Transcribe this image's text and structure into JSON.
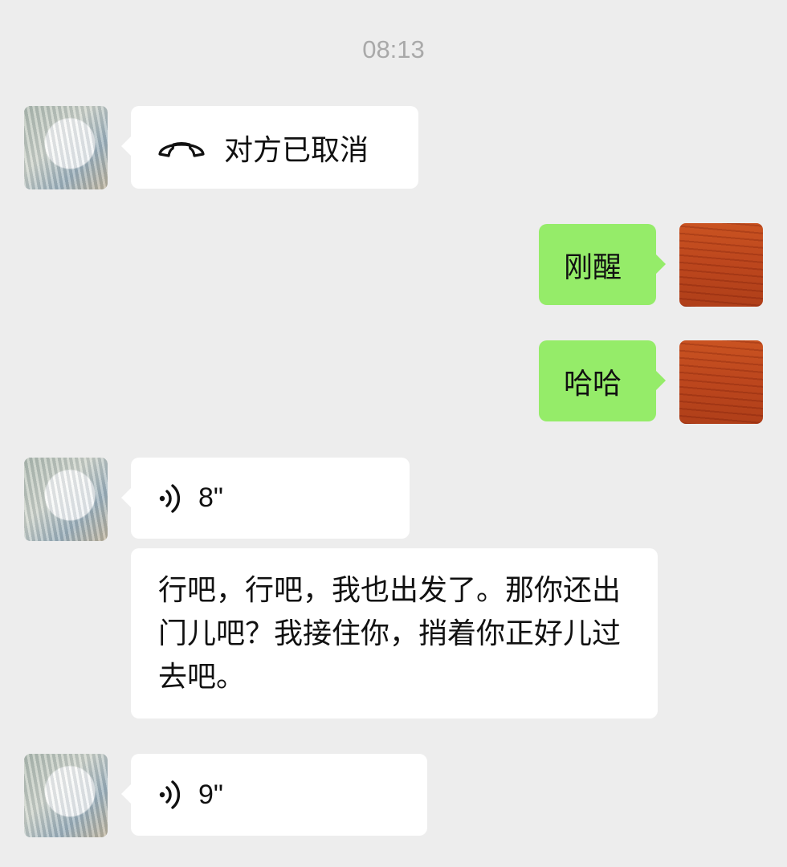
{
  "timestamp": "08:13",
  "messages": [
    {
      "side": "in",
      "type": "call",
      "text": "对方已取消",
      "icon": "hang-up-phone-icon"
    },
    {
      "side": "out",
      "type": "text",
      "text": "刚醒"
    },
    {
      "side": "out",
      "type": "text",
      "text": "哈哈"
    },
    {
      "side": "in",
      "type": "voice",
      "duration": "8\"",
      "icon": "voice-wave-icon"
    },
    {
      "side": "in",
      "type": "text",
      "text": "行吧，行吧，我也出发了。那你还出门儿吧？我接住你，捎着你正好儿过去吧。"
    },
    {
      "side": "in",
      "type": "voice",
      "duration": "9\"",
      "icon": "voice-wave-icon"
    }
  ],
  "colors": {
    "background": "#ededed",
    "incoming_bubble": "#ffffff",
    "outgoing_bubble": "#95ec69",
    "timestamp": "#a9a9a9"
  }
}
